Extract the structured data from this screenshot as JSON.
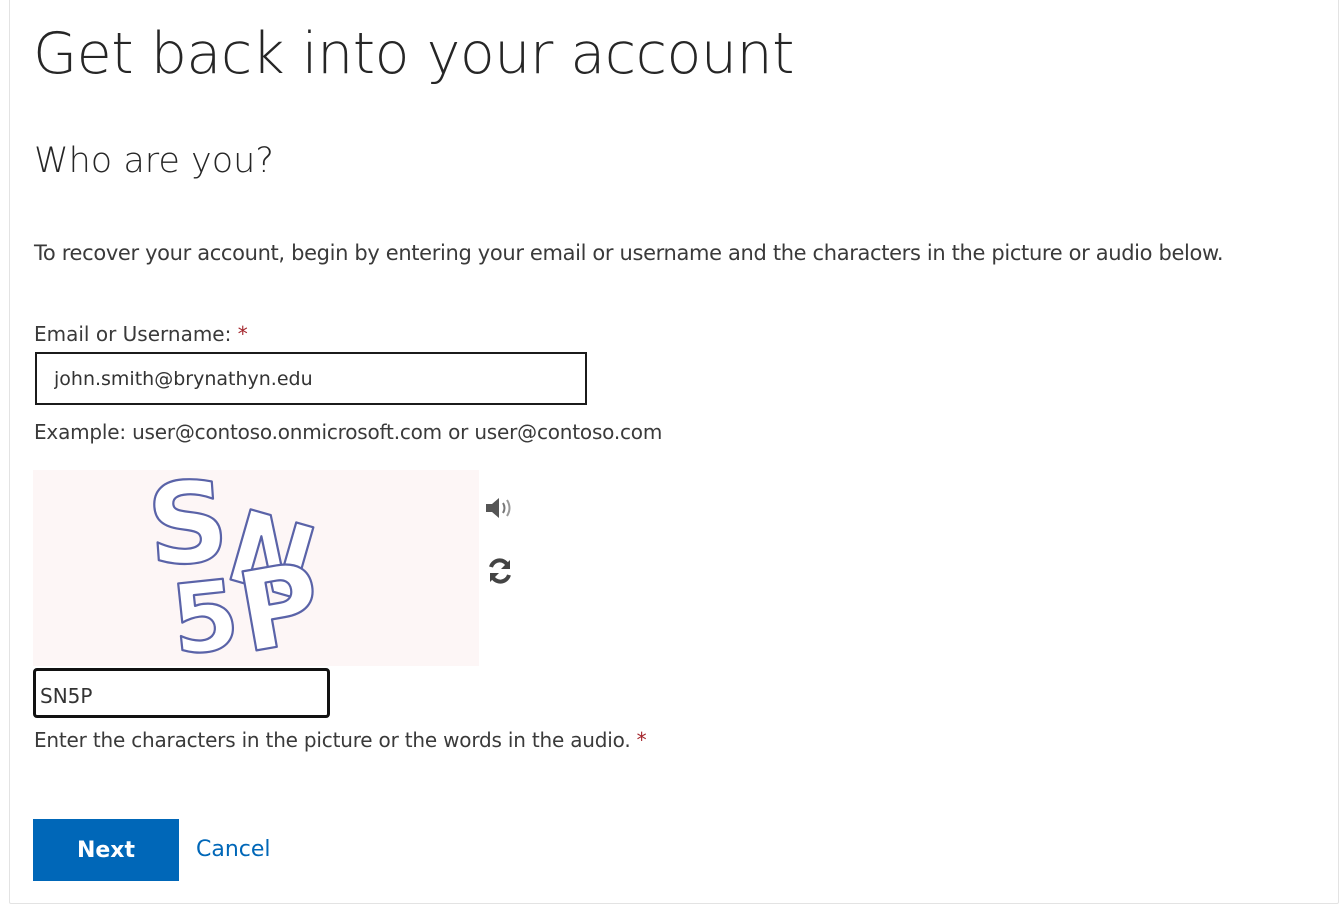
{
  "page": {
    "title": "Get back into your account",
    "subtitle": "Who are you?",
    "intro": "To recover your account, begin by entering your email or username and the characters in the picture or audio below."
  },
  "email_field": {
    "label": "Email or Username:",
    "required_marker": "*",
    "value": "john.smith@brynathyn.edu",
    "example": "Example: user@contoso.onmicrosoft.com or user@contoso.com"
  },
  "captcha": {
    "image_text": "SN5P",
    "audio_icon": "speaker-icon",
    "refresh_icon": "refresh-icon",
    "input_value": "SN5P",
    "hint": "Enter the characters in the picture or the words in the audio.",
    "required_marker": "*"
  },
  "actions": {
    "next_label": "Next",
    "cancel_label": "Cancel"
  },
  "colors": {
    "primary": "#0067b8",
    "required": "#a4262c",
    "captcha_ink": "#5a63a8"
  }
}
